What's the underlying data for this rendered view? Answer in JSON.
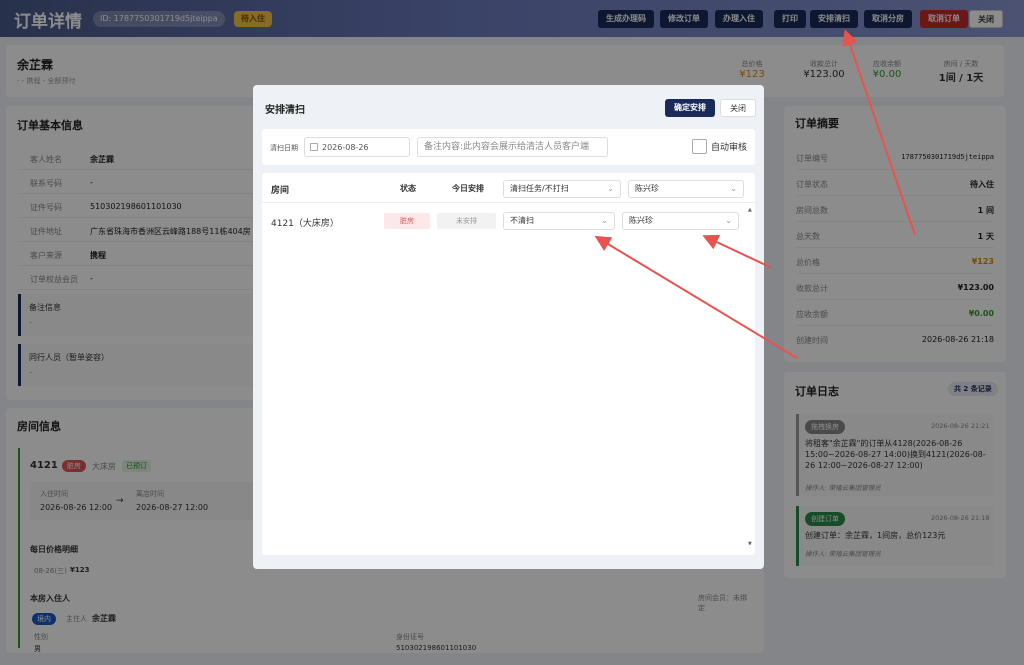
{
  "header": {
    "title": "订单详情",
    "order_id": "ID: 1787750301719d5jteippa",
    "status": "待入住",
    "buttons": [
      "生成办理码",
      "修改订单",
      "办理入住",
      "打印",
      "安排清扫",
      "取消分房",
      "取消订单",
      "关闭"
    ]
  },
  "guest_summary": {
    "name": "余芷霖",
    "sub": "- - 携程 - 全额预付",
    "stats": [
      {
        "label": "总价格",
        "value": "¥123",
        "color": "#e08a00"
      },
      {
        "label": "收款总计",
        "value": "¥123.00",
        "color": "#222"
      },
      {
        "label": "应收余额",
        "value": "¥0.00",
        "color": "#2a9d2a"
      },
      {
        "label": "房间 / 天数",
        "value": "1间 / 1天",
        "color": "#222"
      }
    ]
  },
  "basic_info": {
    "title": "订单基本信息",
    "rows": [
      {
        "label": "客人姓名",
        "value": "余芷霖"
      },
      {
        "label": "联系号码",
        "value": "-"
      },
      {
        "label": "证件号码",
        "value": "510302198601101030"
      },
      {
        "label": "证件地址",
        "value": "广东省珠海市香洲区云峰路188号11栋404房"
      },
      {
        "label": "客户来源",
        "value": "携程"
      },
      {
        "label": "订单权益会员",
        "value": "-"
      }
    ],
    "remark_title": "备注信息",
    "remark_value": "-",
    "companion_title": "同行人员（暂单姿容）",
    "companion_value": "-"
  },
  "room_info": {
    "title": "房间信息",
    "room_no": "4121",
    "room_tag": "脏房",
    "room_type": "大床房",
    "booked": "已预订",
    "checkin_label": "入住时间",
    "checkin": "2026-08-26 12:00",
    "checkout_label": "离店时间",
    "checkout": "2026-08-27 12:00",
    "arrow": "→",
    "daily_title": "每日价格明细",
    "daily_date": "08-26(三)",
    "daily_price": "¥123",
    "occupant_title": "本房入住人",
    "member_status": "房间会员：未绑定",
    "occupant_tag": "境内",
    "main_label": "主住人",
    "occupant_name": "余芷霖",
    "gender_label": "性别",
    "gender": "男",
    "id_label": "身份证号",
    "id_value": "510302198601101030"
  },
  "order_summary": {
    "title": "订单摘要",
    "rows": [
      {
        "label": "订单编号",
        "value": "1787750301719d5jteippa",
        "color": "#222"
      },
      {
        "label": "订单状态",
        "value": "待入住",
        "color": "#222"
      },
      {
        "label": "房间总数",
        "value": "1 间",
        "color": "#222"
      },
      {
        "label": "总天数",
        "value": "1 天",
        "color": "#222"
      },
      {
        "label": "总价格",
        "value": "¥123",
        "color": "#e08a00"
      },
      {
        "label": "收款总计",
        "value": "¥123.00",
        "color": "#222"
      },
      {
        "label": "应收余额",
        "value": "¥0.00",
        "color": "#2a9d2a"
      },
      {
        "label": "创建时间",
        "value": "2026-08-26 21:18",
        "color": "#222"
      }
    ]
  },
  "order_log": {
    "title": "订单日志",
    "count": "共 2 条记录",
    "entries": [
      {
        "tag": "拖拽换房",
        "tag_color": "#888",
        "time": "2026-08-26 21:21",
        "text": "将租客\"余芷霖\"的订单从4128(2026-08-26 15:00~2026-08-27 14:00)换到4121(2026-08-26 12:00~2026-08-27 12:00)",
        "operator": "操作人: 荣禧云集团管理员"
      },
      {
        "tag": "创建订单",
        "tag_color": "#2a8a4a",
        "time": "2026-08-26 21:18",
        "text": "创建订单：余芷霖，1间房，总价123元",
        "operator": "操作人: 荣禧云集团管理员"
      }
    ]
  },
  "modal": {
    "title": "安排清扫",
    "confirm": "确定安排",
    "close": "关闭",
    "date_label": "清扫日期",
    "date_value": "2026-08-26",
    "note_placeholder": "备注内容:此内容会展示给清洁人员客户端",
    "auto_review": "自动审核",
    "col_room": "房间",
    "col_status": "状态",
    "col_today": "今日安排",
    "col_task_select": "清扫任务/不打扫",
    "col_person_select": "陈兴珍",
    "row": {
      "room": "4121（大床房）",
      "status": "脏房",
      "today": "未安排",
      "task": "不清扫",
      "person": "陈兴珍"
    }
  }
}
